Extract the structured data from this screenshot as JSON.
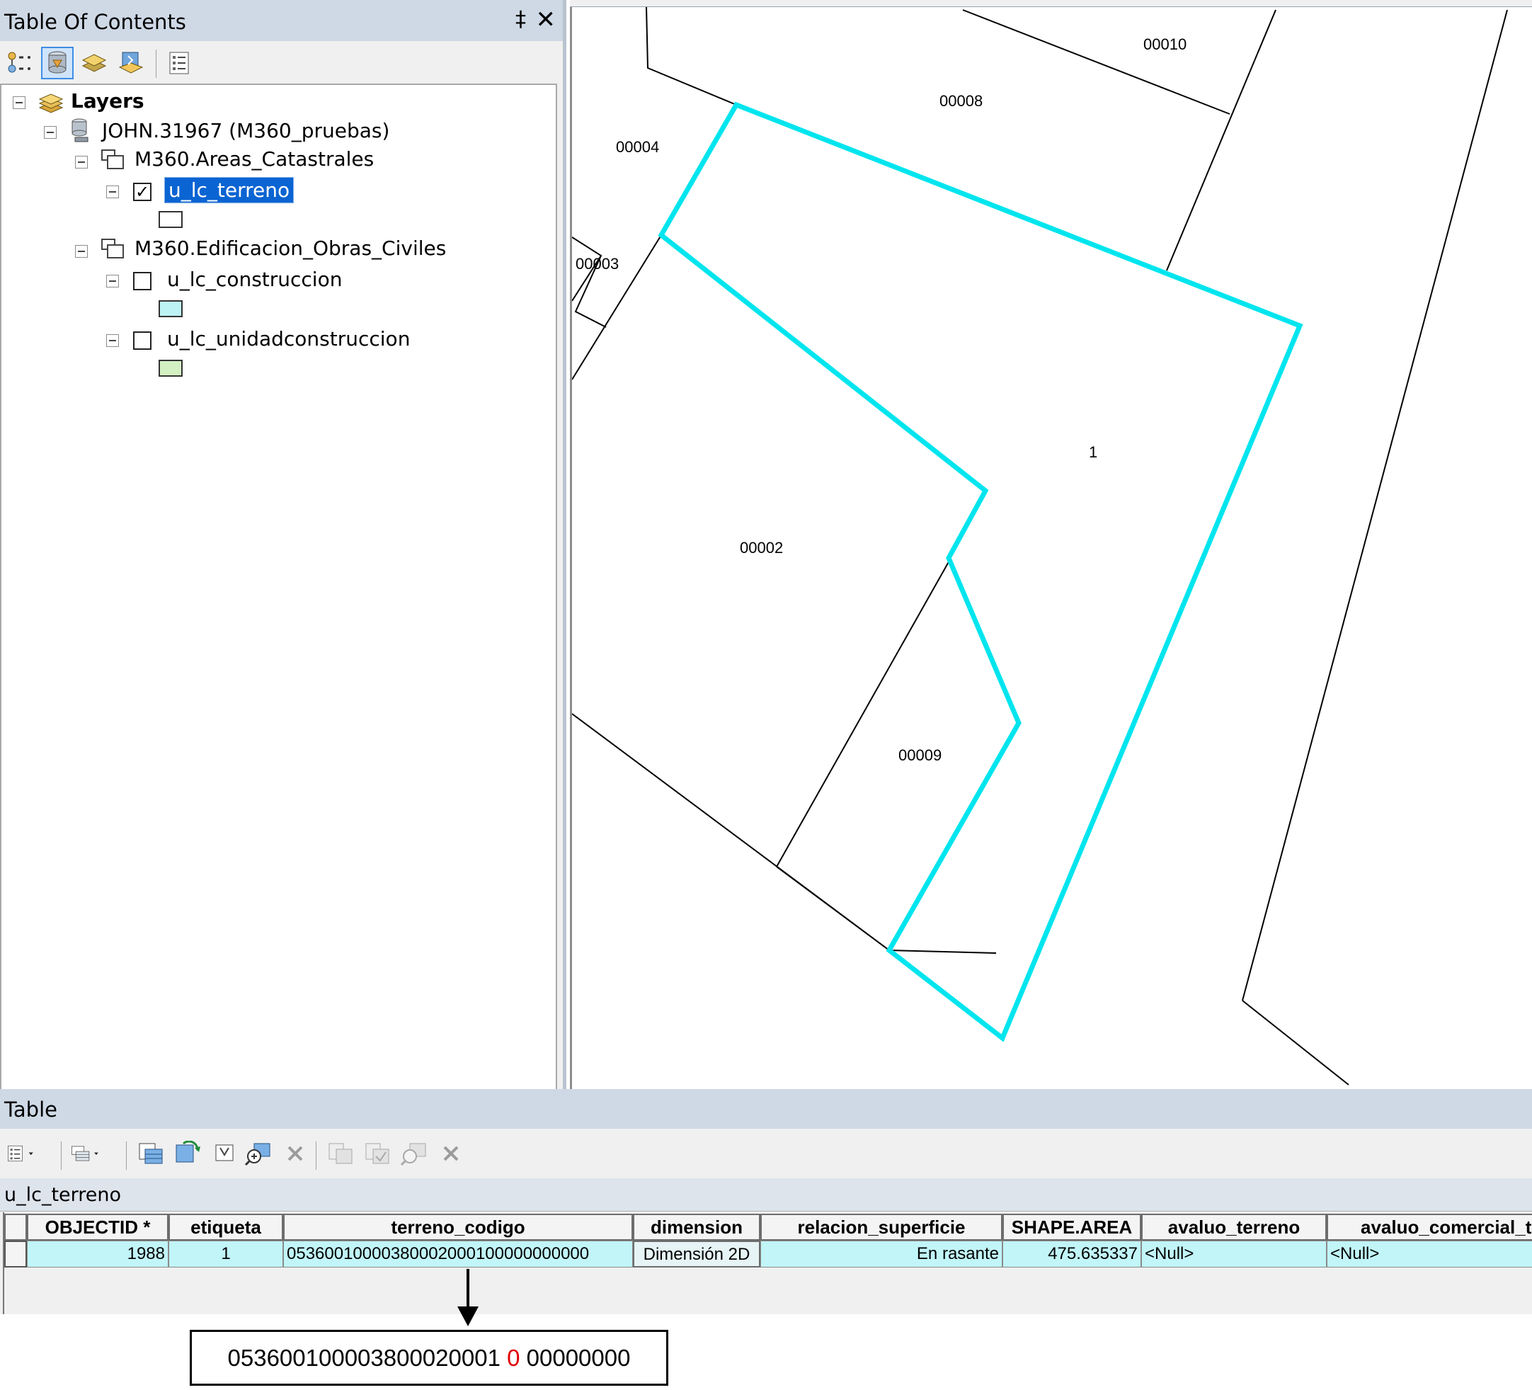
{
  "toc": {
    "title": "Table Of Contents",
    "pin_glyph": "‡",
    "close_glyph": "✕",
    "toolbar": [
      "list-by-drawing-order-icon",
      "list-by-source-icon",
      "list-by-visibility-icon",
      "list-by-selection-icon",
      "options-icon"
    ],
    "tree": {
      "root": "Layers",
      "connection": "JOHN.31967 (M360_pruebas)",
      "groups": [
        {
          "name": "M360.Areas_Catastrales",
          "layers": [
            {
              "name": "u_lc_terreno",
              "checked": true,
              "selected": true,
              "swatch_fill": "#ffffff"
            }
          ]
        },
        {
          "name": "M360.Edificacion_Obras_Civiles",
          "layers": [
            {
              "name": "u_lc_construccion",
              "checked": false,
              "selected": false,
              "swatch_fill": "#bef3f5"
            },
            {
              "name": "u_lc_unidadconstruccion",
              "checked": false,
              "selected": false,
              "swatch_fill": "#d3f0c3"
            }
          ]
        }
      ]
    }
  },
  "map": {
    "parcel_labels": [
      "00010",
      "00008",
      "00004",
      "00003",
      "1",
      "00002",
      "00009"
    ],
    "selection_color": "#00e5ee",
    "line_color": "#000000"
  },
  "table": {
    "title": "Table",
    "tab_name": "u_lc_terreno",
    "toolbar": [
      "table-options-icon",
      "related-tables-icon",
      "select-by-attributes-icon",
      "switch-selection-icon",
      "clear-selection-icon",
      "zoom-to-selected-icon",
      "delete-selected-icon",
      "copy-selected-icon",
      "paste-icon",
      "zoom-to-record-icon",
      "delete-icon"
    ],
    "columns": [
      "OBJECTID *",
      "etiqueta",
      "terreno_codigo",
      "dimension",
      "relacion_superficie",
      "SHAPE.AREA",
      "avaluo_terreno",
      "avaluo_comercial_t"
    ],
    "row": {
      "OBJECTID": "1988",
      "etiqueta": "1",
      "terreno_codigo": "05360010000380002000100000000000",
      "dimension": "Dimensión 2D",
      "relacion_superficie": "En rasante",
      "SHAPE_AREA": "475.635337",
      "avaluo_terreno": "<Null>",
      "avaluo_comercial": "<Null>"
    },
    "row_color": "#c1f5f8"
  },
  "callout": {
    "prefix": "053600100003800020001 ",
    "highlight": "0",
    "suffix": " 00000000",
    "highlight_color": "#e00000"
  }
}
